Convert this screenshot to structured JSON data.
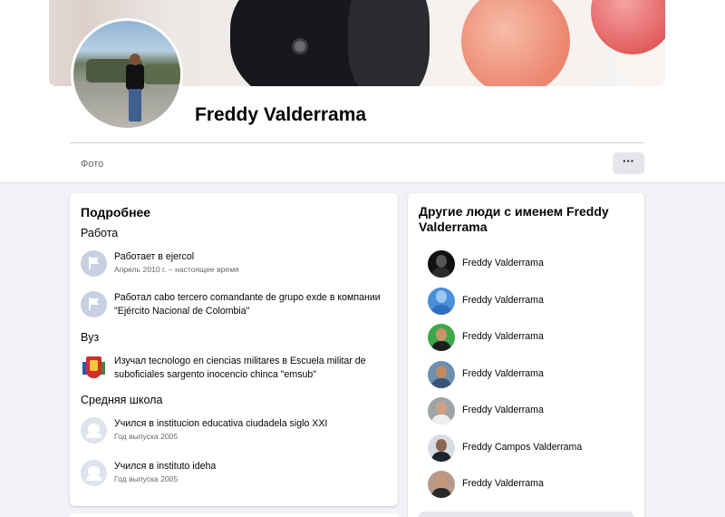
{
  "profile": {
    "name": "Freddy Valderrama",
    "tabs": [
      {
        "label": "Фото"
      }
    ],
    "more_label": "···"
  },
  "about": {
    "title": "Подробнее",
    "work_label": "Работа",
    "work": [
      {
        "prefix": "Работает в ",
        "place": "ejercol",
        "detail": "Апрель 2010 г. – настоящее время",
        "icon": "flag-icon"
      },
      {
        "prefix": "Работал cabo tercero comandante de grupo exde в компании ",
        "place": "\"Ejército Nacional de Colombia\"",
        "detail": "",
        "icon": "flag-icon"
      }
    ],
    "university_label": "Вуз",
    "university": [
      {
        "prefix": "Изучал tecnologo en ciencias militares в ",
        "place": "Escuela militar de suboficiales sargento inocencio chinca \"emsub\"",
        "detail": "",
        "icon": "school-crest-icon"
      }
    ],
    "school_label": "Средняя школа",
    "school": [
      {
        "prefix": "Учился в ",
        "place": "institucion educativa ciudadela siglo XXI",
        "detail": "Год выпуска 2005",
        "icon": "graduation-cap-icon"
      },
      {
        "prefix": "Учился в ",
        "place": "instituto ideha",
        "detail": "Год выпуска 2005",
        "icon": "graduation-cap-icon"
      }
    ]
  },
  "others": {
    "title": "Другие люди с именем Freddy Valderrama",
    "people": [
      {
        "name": "Freddy Valderrama",
        "avatar_bg": "#111111",
        "avatar_fg": "#555555"
      },
      {
        "name": "Freddy Valderrama",
        "avatar_bg": "#4a8fd8",
        "avatar_fg": "#9cc7f0"
      },
      {
        "name": "Freddy Valderrama",
        "avatar_bg": "#3da84a",
        "avatar_fg": "#1d1d1d"
      },
      {
        "name": "Freddy Valderrama",
        "avatar_bg": "#6d8fb0",
        "avatar_fg": "#3b5574"
      },
      {
        "name": "Freddy Valderrama",
        "avatar_bg": "#9fa4a8",
        "avatar_fg": "#eeeeee"
      },
      {
        "name": "Freddy Campos Valderrama",
        "avatar_bg": "#d9dde3",
        "avatar_fg": "#1c2430"
      },
      {
        "name": "Freddy Valderrama",
        "avatar_bg": "#b9998a",
        "avatar_fg": "#2a2a2a"
      }
    ]
  },
  "colors": {
    "page_bg": "#f0f2f5",
    "card_bg": "#ffffff",
    "secondary_text": "#65676b",
    "button_bg": "#e4e6eb"
  }
}
